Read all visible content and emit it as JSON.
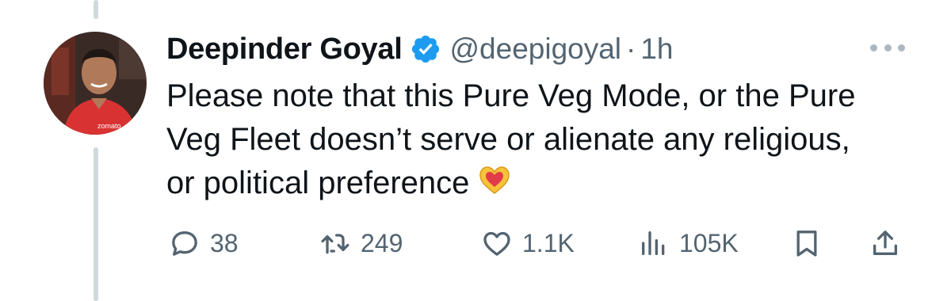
{
  "tweet": {
    "author_name": "Deepinder Goyal",
    "handle": "@deepigoyal",
    "separator": "·",
    "time": "1h",
    "text": "Please note that this Pure Veg Mode, or the Pure Veg Fleet doesn’t serve or alienate any religious, or political preference",
    "emoji": "heart-hands-emoji",
    "avatar_shirt_text": "zomato"
  },
  "actions": {
    "replies": "38",
    "reposts": "249",
    "likes": "1.1K",
    "views": "105K"
  },
  "icons": {
    "verified": "verified-badge-icon",
    "more": "more-icon",
    "reply": "reply-icon",
    "repost": "repost-icon",
    "like": "like-icon",
    "views": "views-icon",
    "bookmark": "bookmark-icon",
    "share": "share-icon"
  },
  "colors": {
    "verified_blue": "#1d9bf0",
    "muted": "#536471",
    "text": "#0f1419",
    "thread_line": "#cfd9de"
  }
}
